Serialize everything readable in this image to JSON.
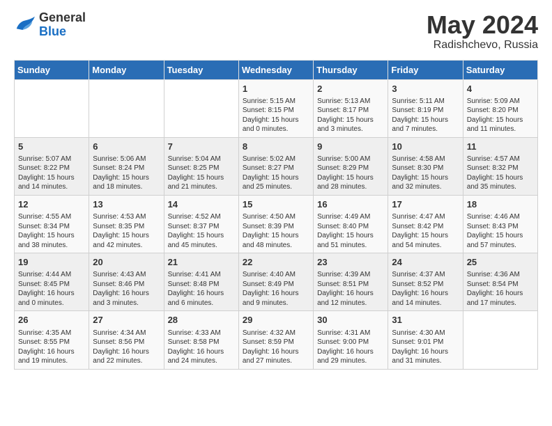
{
  "header": {
    "logo_general": "General",
    "logo_blue": "Blue",
    "month_year": "May 2024",
    "location": "Radishchevo, Russia"
  },
  "days_of_week": [
    "Sunday",
    "Monday",
    "Tuesday",
    "Wednesday",
    "Thursday",
    "Friday",
    "Saturday"
  ],
  "weeks": [
    [
      {
        "day": "",
        "sunrise": "",
        "sunset": "",
        "daylight": ""
      },
      {
        "day": "",
        "sunrise": "",
        "sunset": "",
        "daylight": ""
      },
      {
        "day": "",
        "sunrise": "",
        "sunset": "",
        "daylight": ""
      },
      {
        "day": "1",
        "sunrise": "Sunrise: 5:15 AM",
        "sunset": "Sunset: 8:15 PM",
        "daylight": "Daylight: 15 hours and 0 minutes."
      },
      {
        "day": "2",
        "sunrise": "Sunrise: 5:13 AM",
        "sunset": "Sunset: 8:17 PM",
        "daylight": "Daylight: 15 hours and 3 minutes."
      },
      {
        "day": "3",
        "sunrise": "Sunrise: 5:11 AM",
        "sunset": "Sunset: 8:19 PM",
        "daylight": "Daylight: 15 hours and 7 minutes."
      },
      {
        "day": "4",
        "sunrise": "Sunrise: 5:09 AM",
        "sunset": "Sunset: 8:20 PM",
        "daylight": "Daylight: 15 hours and 11 minutes."
      }
    ],
    [
      {
        "day": "5",
        "sunrise": "Sunrise: 5:07 AM",
        "sunset": "Sunset: 8:22 PM",
        "daylight": "Daylight: 15 hours and 14 minutes."
      },
      {
        "day": "6",
        "sunrise": "Sunrise: 5:06 AM",
        "sunset": "Sunset: 8:24 PM",
        "daylight": "Daylight: 15 hours and 18 minutes."
      },
      {
        "day": "7",
        "sunrise": "Sunrise: 5:04 AM",
        "sunset": "Sunset: 8:25 PM",
        "daylight": "Daylight: 15 hours and 21 minutes."
      },
      {
        "day": "8",
        "sunrise": "Sunrise: 5:02 AM",
        "sunset": "Sunset: 8:27 PM",
        "daylight": "Daylight: 15 hours and 25 minutes."
      },
      {
        "day": "9",
        "sunrise": "Sunrise: 5:00 AM",
        "sunset": "Sunset: 8:29 PM",
        "daylight": "Daylight: 15 hours and 28 minutes."
      },
      {
        "day": "10",
        "sunrise": "Sunrise: 4:58 AM",
        "sunset": "Sunset: 8:30 PM",
        "daylight": "Daylight: 15 hours and 32 minutes."
      },
      {
        "day": "11",
        "sunrise": "Sunrise: 4:57 AM",
        "sunset": "Sunset: 8:32 PM",
        "daylight": "Daylight: 15 hours and 35 minutes."
      }
    ],
    [
      {
        "day": "12",
        "sunrise": "Sunrise: 4:55 AM",
        "sunset": "Sunset: 8:34 PM",
        "daylight": "Daylight: 15 hours and 38 minutes."
      },
      {
        "day": "13",
        "sunrise": "Sunrise: 4:53 AM",
        "sunset": "Sunset: 8:35 PM",
        "daylight": "Daylight: 15 hours and 42 minutes."
      },
      {
        "day": "14",
        "sunrise": "Sunrise: 4:52 AM",
        "sunset": "Sunset: 8:37 PM",
        "daylight": "Daylight: 15 hours and 45 minutes."
      },
      {
        "day": "15",
        "sunrise": "Sunrise: 4:50 AM",
        "sunset": "Sunset: 8:39 PM",
        "daylight": "Daylight: 15 hours and 48 minutes."
      },
      {
        "day": "16",
        "sunrise": "Sunrise: 4:49 AM",
        "sunset": "Sunset: 8:40 PM",
        "daylight": "Daylight: 15 hours and 51 minutes."
      },
      {
        "day": "17",
        "sunrise": "Sunrise: 4:47 AM",
        "sunset": "Sunset: 8:42 PM",
        "daylight": "Daylight: 15 hours and 54 minutes."
      },
      {
        "day": "18",
        "sunrise": "Sunrise: 4:46 AM",
        "sunset": "Sunset: 8:43 PM",
        "daylight": "Daylight: 15 hours and 57 minutes."
      }
    ],
    [
      {
        "day": "19",
        "sunrise": "Sunrise: 4:44 AM",
        "sunset": "Sunset: 8:45 PM",
        "daylight": "Daylight: 16 hours and 0 minutes."
      },
      {
        "day": "20",
        "sunrise": "Sunrise: 4:43 AM",
        "sunset": "Sunset: 8:46 PM",
        "daylight": "Daylight: 16 hours and 3 minutes."
      },
      {
        "day": "21",
        "sunrise": "Sunrise: 4:41 AM",
        "sunset": "Sunset: 8:48 PM",
        "daylight": "Daylight: 16 hours and 6 minutes."
      },
      {
        "day": "22",
        "sunrise": "Sunrise: 4:40 AM",
        "sunset": "Sunset: 8:49 PM",
        "daylight": "Daylight: 16 hours and 9 minutes."
      },
      {
        "day": "23",
        "sunrise": "Sunrise: 4:39 AM",
        "sunset": "Sunset: 8:51 PM",
        "daylight": "Daylight: 16 hours and 12 minutes."
      },
      {
        "day": "24",
        "sunrise": "Sunrise: 4:37 AM",
        "sunset": "Sunset: 8:52 PM",
        "daylight": "Daylight: 16 hours and 14 minutes."
      },
      {
        "day": "25",
        "sunrise": "Sunrise: 4:36 AM",
        "sunset": "Sunset: 8:54 PM",
        "daylight": "Daylight: 16 hours and 17 minutes."
      }
    ],
    [
      {
        "day": "26",
        "sunrise": "Sunrise: 4:35 AM",
        "sunset": "Sunset: 8:55 PM",
        "daylight": "Daylight: 16 hours and 19 minutes."
      },
      {
        "day": "27",
        "sunrise": "Sunrise: 4:34 AM",
        "sunset": "Sunset: 8:56 PM",
        "daylight": "Daylight: 16 hours and 22 minutes."
      },
      {
        "day": "28",
        "sunrise": "Sunrise: 4:33 AM",
        "sunset": "Sunset: 8:58 PM",
        "daylight": "Daylight: 16 hours and 24 minutes."
      },
      {
        "day": "29",
        "sunrise": "Sunrise: 4:32 AM",
        "sunset": "Sunset: 8:59 PM",
        "daylight": "Daylight: 16 hours and 27 minutes."
      },
      {
        "day": "30",
        "sunrise": "Sunrise: 4:31 AM",
        "sunset": "Sunset: 9:00 PM",
        "daylight": "Daylight: 16 hours and 29 minutes."
      },
      {
        "day": "31",
        "sunrise": "Sunrise: 4:30 AM",
        "sunset": "Sunset: 9:01 PM",
        "daylight": "Daylight: 16 hours and 31 minutes."
      },
      {
        "day": "",
        "sunrise": "",
        "sunset": "",
        "daylight": ""
      }
    ]
  ]
}
